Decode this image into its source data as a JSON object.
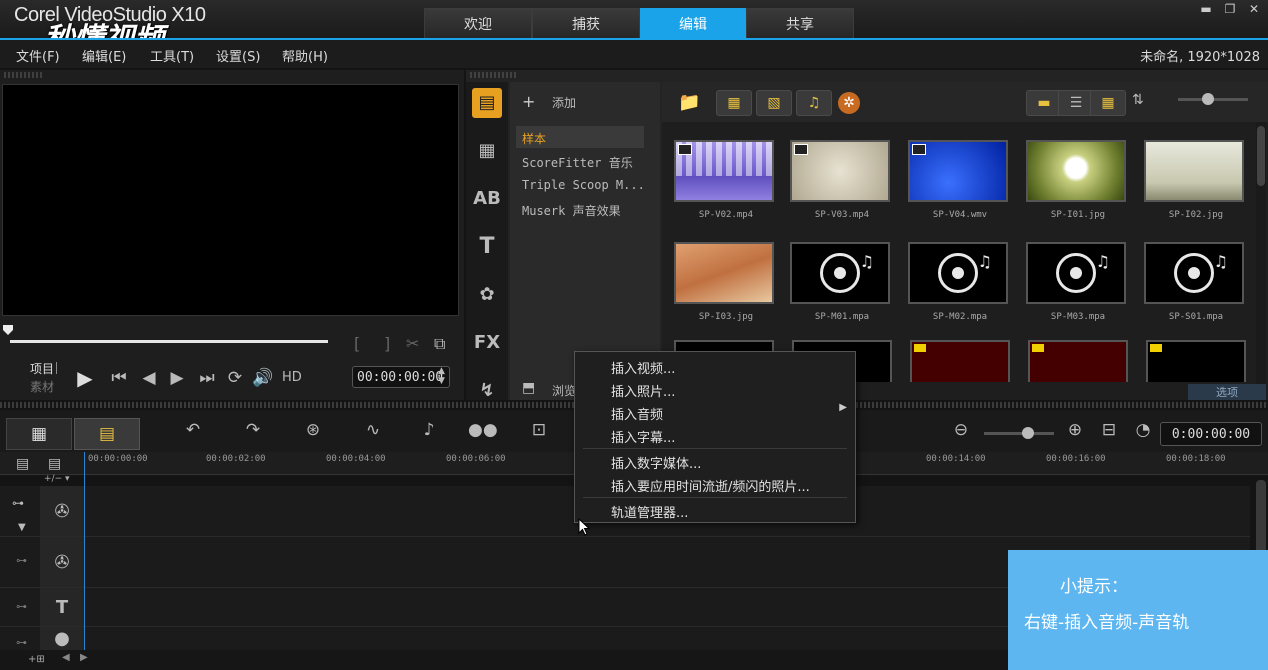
{
  "app": {
    "brand": "Corel VideoStudio X10",
    "watermark": "秒懂视频",
    "project_info": "未命名, 1920*1028"
  },
  "tabs": [
    {
      "label": "欢迎",
      "active": false
    },
    {
      "label": "捕获",
      "active": false
    },
    {
      "label": "编辑",
      "active": true
    },
    {
      "label": "共享",
      "active": false
    }
  ],
  "menu": [
    "文件(F)",
    "编辑(E)",
    "工具(T)",
    "设置(S)",
    "帮助(H)"
  ],
  "preview": {
    "mode_project": "项目",
    "mode_clip": "素材",
    "hd_label": "HD",
    "timecode": "00:00:00:00"
  },
  "library": {
    "add_label": "添加",
    "folders": [
      "样本",
      "ScoreFitter 音乐",
      "Triple Scoop M...",
      "Muserk 声音效果"
    ],
    "browse_label": "浏览",
    "options_label": "选项",
    "thumbnails": [
      {
        "name": "SP-V02.mp4",
        "kind": "video-purple"
      },
      {
        "name": "SP-V03.mp4",
        "kind": "video-beige"
      },
      {
        "name": "SP-V04.wmv",
        "kind": "video-blue"
      },
      {
        "name": "SP-I01.jpg",
        "kind": "image-dandelion"
      },
      {
        "name": "SP-I02.jpg",
        "kind": "image-trees"
      },
      {
        "name": "SP-I03.jpg",
        "kind": "image-desert"
      },
      {
        "name": "SP-M01.mpa",
        "kind": "audio"
      },
      {
        "name": "SP-M02.mpa",
        "kind": "audio"
      },
      {
        "name": "SP-M03.mpa",
        "kind": "audio"
      },
      {
        "name": "SP-S01.mpa",
        "kind": "audio"
      }
    ]
  },
  "timeline": {
    "timecode": "0:00:00:00",
    "ruler": [
      "00:00:00:00",
      "00:00:02:00",
      "00:00:04:00",
      "00:00:06:00",
      "00:00:14:00",
      "00:00:16:00",
      "00:00:18:00"
    ],
    "track_icons": [
      "film-reel-icon",
      "film-reel-icon",
      "title-icon"
    ]
  },
  "context_menu": {
    "items": [
      "插入视频...",
      "插入照片...",
      "插入音频",
      "插入字幕...",
      "插入数字媒体...",
      "插入要应用时间流逝/频闪的照片...",
      "轨道管理器..."
    ]
  },
  "tip": {
    "title": "小提示：",
    "text": "右键-插入音频-声音轨"
  },
  "colors": {
    "accent": "#1aa3e8",
    "tip_bg": "#5eb6f0"
  }
}
